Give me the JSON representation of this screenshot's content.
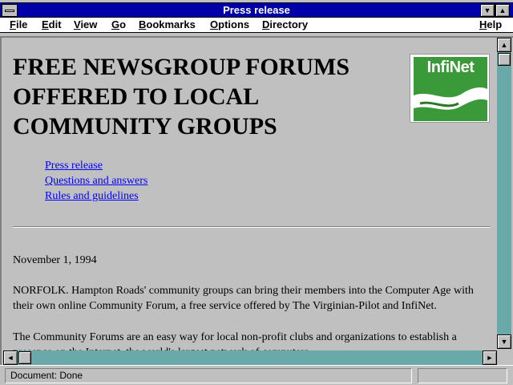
{
  "window": {
    "title": "Press release"
  },
  "menubar": {
    "items": [
      {
        "label": "File",
        "accel": "F",
        "rest": "ile"
      },
      {
        "label": "Edit",
        "accel": "E",
        "rest": "dit"
      },
      {
        "label": "View",
        "accel": "V",
        "rest": "iew"
      },
      {
        "label": "Go",
        "accel": "G",
        "rest": "o"
      },
      {
        "label": "Bookmarks",
        "accel": "B",
        "rest": "ookmarks"
      },
      {
        "label": "Options",
        "accel": "O",
        "rest": "ptions"
      },
      {
        "label": "Directory",
        "accel": "D",
        "rest": "irectory"
      },
      {
        "label": "Help",
        "accel": "H",
        "rest": "elp"
      }
    ]
  },
  "page": {
    "headline": "FREE NEWSGROUP FORUMS OFFERED TO LOCAL COMMUNITY GROUPS",
    "logo_text": "InfiNet",
    "links": [
      "Press release",
      "Questions and answers",
      "Rules and guidelines"
    ],
    "date": "November 1, 1994",
    "paragraph1": "NORFOLK. Hampton Roads' community groups can bring their members into the Computer Age with their own online Community Forum, a free service offered by The Virginian-Pilot and InfiNet.",
    "paragraph2": "The Community Forums are an easy way for local non-profit clubs and organizations to establish a presence on the Internet, the world's largest network of computers."
  },
  "status": {
    "text": "Document: Done"
  },
  "colors": {
    "title_bar": "#0000a8",
    "link": "#0000ff",
    "scroll_track": "#6aa9a9",
    "logo_green": "#3a9a3a"
  }
}
